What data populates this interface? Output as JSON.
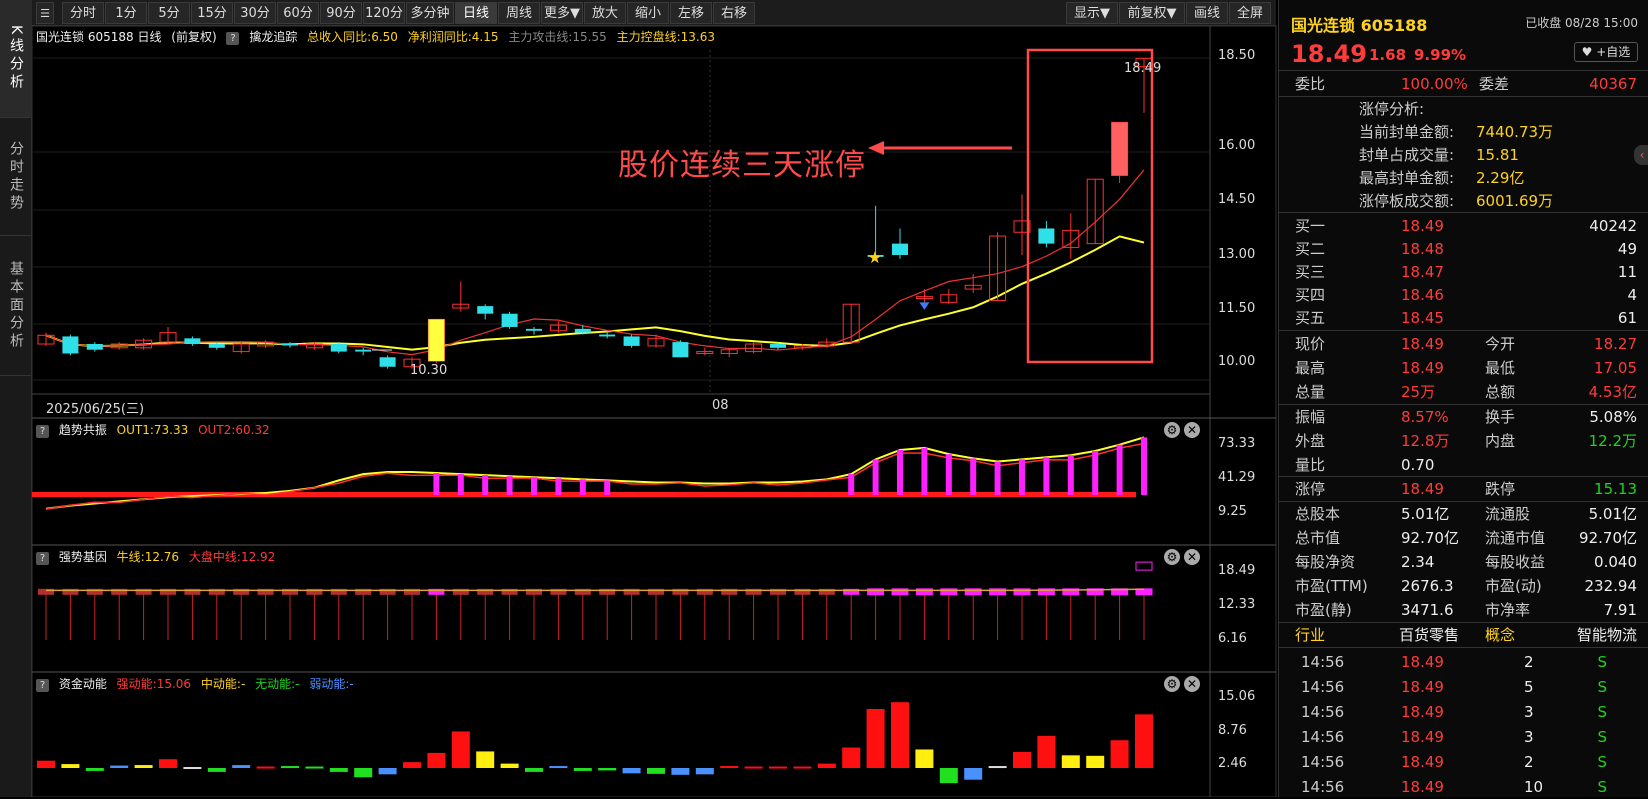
{
  "vtabs": [
    "K线分析",
    "分时走势",
    "基本面分析"
  ],
  "toolbar": {
    "items": [
      "分时",
      "1分",
      "5分",
      "15分",
      "30分",
      "60分",
      "90分",
      "120分",
      "多分钟",
      "日线",
      "周线",
      "更多▼",
      "放大",
      "缩小",
      "左移",
      "右移"
    ],
    "right": [
      "显示▼",
      "前复权▼",
      "画线",
      "全屏"
    ],
    "active": "日线"
  },
  "main_chart": {
    "header": {
      "title": "国光连锁 605188 日线",
      "fq": "(前复权)",
      "indicator": "擒龙追踪",
      "item1": "总收入同比:6.50",
      "item2": "净利润同比:4.15",
      "item3": "主力攻击线:15.55",
      "item4": "主力控盘线:13.63"
    },
    "yticks": [
      "18.50",
      "16.00",
      "14.50",
      "13.00",
      "11.50",
      "10.00"
    ],
    "date_left": "2025/06/25(三)",
    "date_mid": "08",
    "low_label": "10.30",
    "high_label": "18.49",
    "annotation": "股价连续三天涨停"
  },
  "pane1": {
    "name": "趋势共振",
    "out1": "OUT1:73.33",
    "out2": "OUT2:60.32",
    "yticks": [
      "73.33",
      "41.29",
      "9.25"
    ]
  },
  "pane2": {
    "name": "强势基因",
    "bull": "牛线:12.76",
    "mid": "大盘中线:12.92",
    "yticks": [
      "18.49",
      "12.33",
      "6.16"
    ]
  },
  "pane3": {
    "name": "资金动能",
    "strong": "强动能:15.06",
    "mid": "中动能:-",
    "none": "无动能:-",
    "weak": "弱动能:-",
    "yticks": [
      "15.06",
      "8.76",
      "2.46"
    ]
  },
  "quote": {
    "name": "国光连锁",
    "code": "605188",
    "status": "已收盘 08/28 15:00",
    "price": "18.49",
    "change": "1.68",
    "pct": "9.99%",
    "fav": "♥ +自选",
    "weibi_l": "委比",
    "weibi": "100.00%",
    "weicha_l": "委差",
    "weicha": "40367",
    "zt_title": "涨停分析:",
    "zt": [
      [
        "当前封单金额:",
        "7440.73万"
      ],
      [
        "封单占成交量:",
        "15.81"
      ],
      [
        "最高封单金额:",
        "2.29亿"
      ],
      [
        "涨停板成交额:",
        "6001.69万"
      ]
    ],
    "bids": [
      [
        "买一",
        "18.49",
        "40242"
      ],
      [
        "买二",
        "18.48",
        "49"
      ],
      [
        "买三",
        "18.47",
        "11"
      ],
      [
        "买四",
        "18.46",
        "4"
      ],
      [
        "买五",
        "18.45",
        "61"
      ]
    ],
    "stats": [
      [
        "现价",
        "18.49",
        "今开",
        "18.27"
      ],
      [
        "最高",
        "18.49",
        "最低",
        "17.05"
      ],
      [
        "总量",
        "25万",
        "总额",
        "4.53亿"
      ]
    ],
    "stats2": [
      [
        "振幅",
        "8.57%",
        "换手",
        "5.08%"
      ],
      [
        "外盘",
        "12.8万",
        "内盘",
        "12.2万"
      ],
      [
        "量比",
        "0.70",
        "",
        ""
      ]
    ],
    "limits": [
      "涨停",
      "18.49",
      "跌停",
      "15.13"
    ],
    "fund": [
      [
        "总股本",
        "5.01亿",
        "流通股",
        "5.01亿"
      ],
      [
        "总市值",
        "92.70亿",
        "流通市值",
        "92.70亿"
      ],
      [
        "每股净资",
        "2.34",
        "每股收益",
        "0.040"
      ],
      [
        "市盈(TTM)",
        "2676.3",
        "市盈(动)",
        "232.94"
      ],
      [
        "市盈(静)",
        "3471.6",
        "市净率",
        "7.91"
      ]
    ],
    "tags": [
      "行业",
      "百货零售",
      "概念",
      "智能物流"
    ],
    "ticks": [
      [
        "14:56",
        "18.49",
        "2",
        "S"
      ],
      [
        "14:56",
        "18.49",
        "5",
        "S"
      ],
      [
        "14:56",
        "18.49",
        "3",
        "S"
      ],
      [
        "14:56",
        "18.49",
        "3",
        "S"
      ],
      [
        "14:56",
        "18.49",
        "2",
        "S"
      ],
      [
        "14:56",
        "18.49",
        "10",
        "S"
      ]
    ]
  },
  "chart_data": {
    "type": "candlestick",
    "symbol": "国光连锁 605188",
    "candles": [
      {
        "o": 10.95,
        "c": 11.18,
        "h": 11.25,
        "l": 10.9
      },
      {
        "o": 11.15,
        "c": 10.7,
        "h": 11.2,
        "l": 10.65
      },
      {
        "o": 10.95,
        "c": 10.8,
        "h": 11.0,
        "l": 10.75
      },
      {
        "o": 10.85,
        "c": 10.95,
        "h": 11.0,
        "l": 10.8
      },
      {
        "o": 10.85,
        "c": 11.05,
        "h": 11.1,
        "l": 10.8
      },
      {
        "o": 11.0,
        "c": 11.25,
        "h": 11.4,
        "l": 10.95
      },
      {
        "o": 11.1,
        "c": 10.95,
        "h": 11.15,
        "l": 10.9
      },
      {
        "o": 10.95,
        "c": 10.85,
        "h": 11.0,
        "l": 10.8
      },
      {
        "o": 10.75,
        "c": 10.95,
        "h": 11.0,
        "l": 10.7
      },
      {
        "o": 10.9,
        "c": 11.0,
        "h": 11.05,
        "l": 10.85
      },
      {
        "o": 10.95,
        "c": 10.92,
        "h": 11.0,
        "l": 10.85
      },
      {
        "o": 10.85,
        "c": 10.95,
        "h": 11.0,
        "l": 10.8
      },
      {
        "o": 10.95,
        "c": 10.75,
        "h": 11.0,
        "l": 10.7
      },
      {
        "o": 10.8,
        "c": 10.75,
        "h": 10.85,
        "l": 10.65
      },
      {
        "o": 10.6,
        "c": 10.35,
        "h": 10.65,
        "l": 10.3
      },
      {
        "o": 10.35,
        "c": 10.55,
        "h": 10.6,
        "l": 10.3
      },
      {
        "o": 10.5,
        "c": 11.6,
        "h": 11.6,
        "l": 10.45
      },
      {
        "o": 11.9,
        "c": 12.0,
        "h": 12.6,
        "l": 11.8
      },
      {
        "o": 11.95,
        "c": 11.75,
        "h": 12.0,
        "l": 11.6
      },
      {
        "o": 11.75,
        "c": 11.4,
        "h": 11.8,
        "l": 11.35
      },
      {
        "o": 11.35,
        "c": 11.3,
        "h": 11.4,
        "l": 11.2
      },
      {
        "o": 11.3,
        "c": 11.45,
        "h": 11.55,
        "l": 11.25
      },
      {
        "o": 11.35,
        "c": 11.25,
        "h": 11.45,
        "l": 11.2
      },
      {
        "o": 11.2,
        "c": 11.15,
        "h": 11.3,
        "l": 11.1
      },
      {
        "o": 11.15,
        "c": 10.9,
        "h": 11.2,
        "l": 10.85
      },
      {
        "o": 10.9,
        "c": 11.1,
        "h": 11.2,
        "l": 10.85
      },
      {
        "o": 11.0,
        "c": 10.6,
        "h": 11.05,
        "l": 10.6
      },
      {
        "o": 10.7,
        "c": 10.75,
        "h": 10.85,
        "l": 10.65
      },
      {
        "o": 10.7,
        "c": 10.8,
        "h": 10.85,
        "l": 10.6
      },
      {
        "o": 10.75,
        "c": 10.95,
        "h": 11.0,
        "l": 10.7
      },
      {
        "o": 10.95,
        "c": 10.85,
        "h": 11.0,
        "l": 10.8
      },
      {
        "o": 10.85,
        "c": 10.9,
        "h": 10.95,
        "l": 10.8
      },
      {
        "o": 10.9,
        "c": 11.0,
        "h": 11.1,
        "l": 10.85
      },
      {
        "o": 11.0,
        "c": 12.0,
        "h": 12.0,
        "l": 10.95
      },
      {
        "o": 13.3,
        "c": 13.25,
        "h": 14.6,
        "l": 13.2
      },
      {
        "o": 13.6,
        "c": 13.3,
        "h": 14.0,
        "l": 13.2
      },
      {
        "o": 12.15,
        "c": 12.2,
        "h": 12.4,
        "l": 12.0
      },
      {
        "o": 12.05,
        "c": 12.25,
        "h": 12.4,
        "l": 12.0
      },
      {
        "o": 12.4,
        "c": 12.5,
        "h": 12.8,
        "l": 12.3
      },
      {
        "o": 12.1,
        "c": 13.8,
        "h": 13.9,
        "l": 12.1
      },
      {
        "o": 13.9,
        "c": 14.2,
        "h": 14.9,
        "l": 13.3
      },
      {
        "o": 14.0,
        "c": 13.6,
        "h": 14.2,
        "l": 13.5
      },
      {
        "o": 13.5,
        "c": 13.95,
        "h": 14.4,
        "l": 13.2
      },
      {
        "o": 13.6,
        "c": 15.3,
        "h": 15.3,
        "l": 13.6
      },
      {
        "o": 15.4,
        "c": 16.8,
        "h": 16.8,
        "l": 15.2
      },
      {
        "o": 18.27,
        "c": 18.49,
        "h": 18.49,
        "l": 17.05
      }
    ],
    "ma_yellow_end": 13.63,
    "ma_red_end": 15.55,
    "ylim": [
      10.0,
      18.5
    ]
  }
}
